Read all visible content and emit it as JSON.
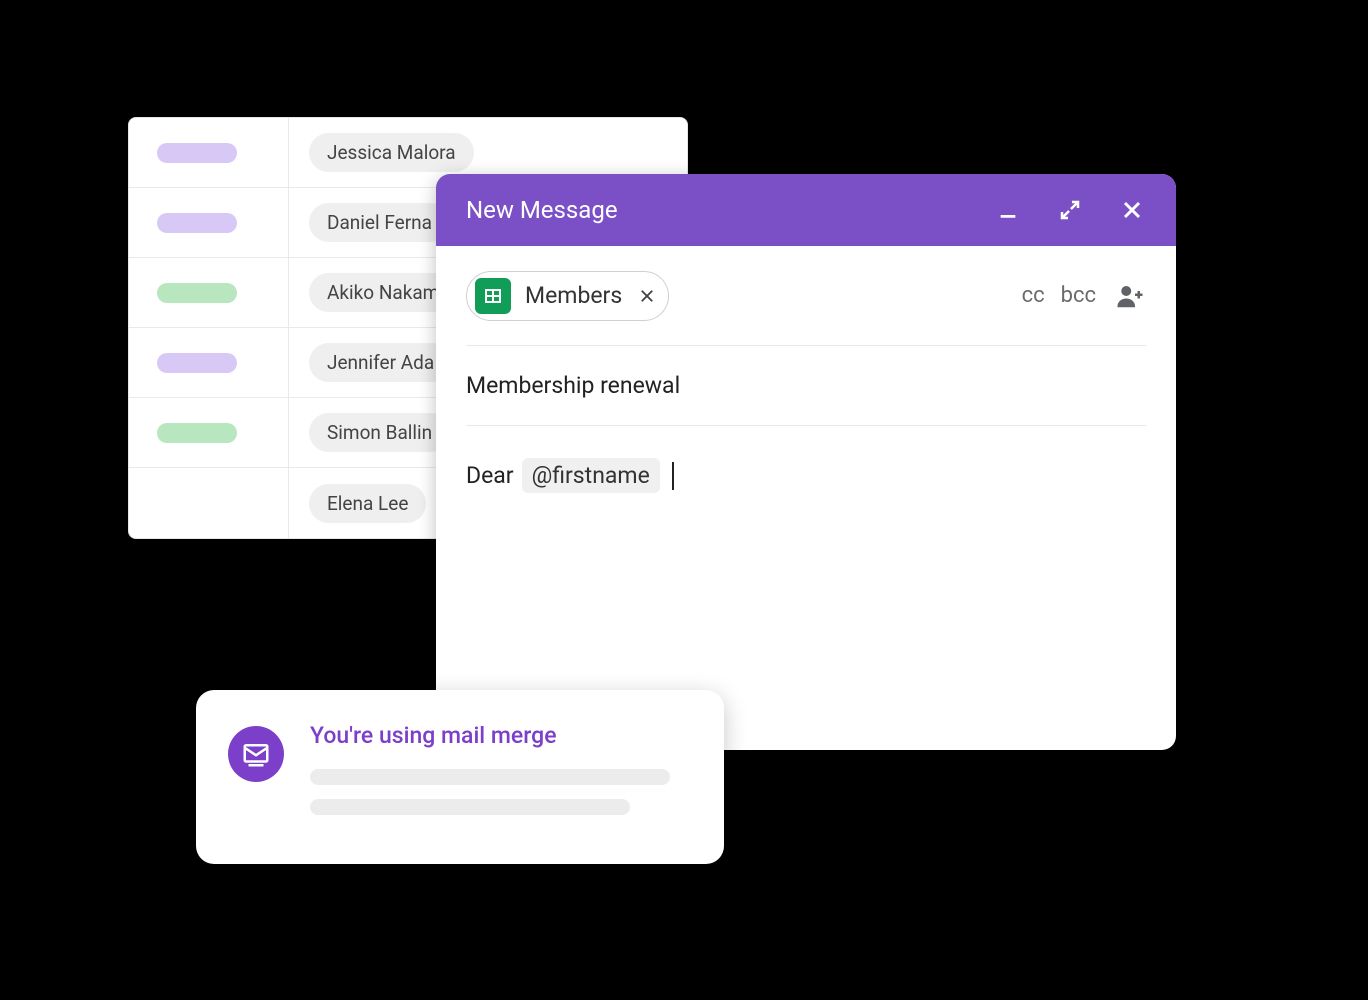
{
  "spreadsheet": {
    "rows": [
      {
        "status_color": "purple",
        "name": "Jessica Malora"
      },
      {
        "status_color": "purple",
        "name": "Daniel Ferna"
      },
      {
        "status_color": "green",
        "name": "Akiko Nakam"
      },
      {
        "status_color": "purple",
        "name": "Jennifer Ada"
      },
      {
        "status_color": "green",
        "name": "Simon Ballin"
      },
      {
        "status_color": "",
        "name": "Elena Lee"
      }
    ]
  },
  "compose": {
    "title": "New Message",
    "recipient_chip": "Members",
    "cc_label": "cc",
    "bcc_label": "bcc",
    "subject": "Membership renewal",
    "body_prefix": "Dear",
    "merge_token": "@firstname"
  },
  "toast": {
    "title": "You're using mail merge"
  },
  "colors": {
    "accent": "#7b50c7",
    "toast_accent": "#7b3fc9",
    "sheets_green": "#0f9d58"
  }
}
